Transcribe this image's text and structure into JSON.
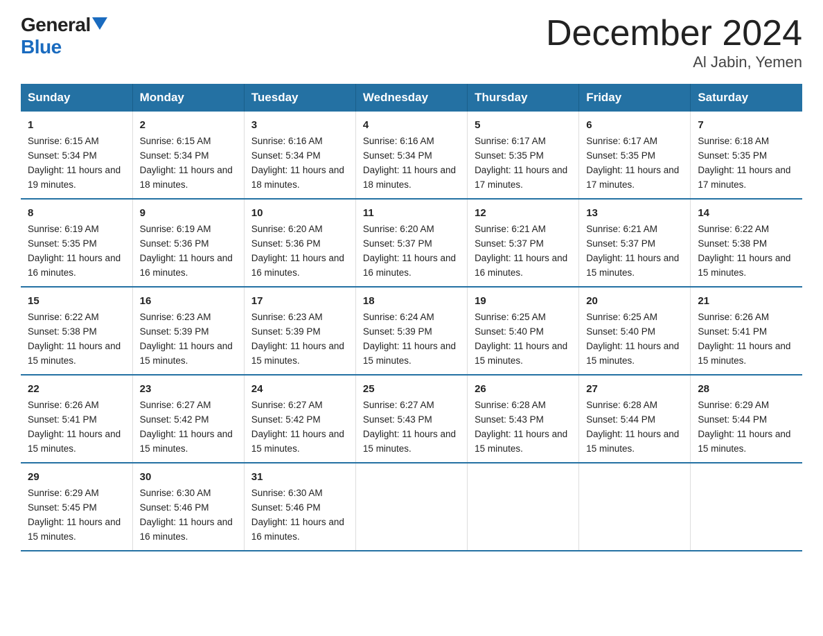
{
  "logo": {
    "general": "General",
    "blue": "Blue",
    "triangle": "▲"
  },
  "title": "December 2024",
  "subtitle": "Al Jabin, Yemen",
  "days_of_week": [
    "Sunday",
    "Monday",
    "Tuesday",
    "Wednesday",
    "Thursday",
    "Friday",
    "Saturday"
  ],
  "weeks": [
    [
      {
        "day": "1",
        "sunrise": "6:15 AM",
        "sunset": "5:34 PM",
        "daylight": "11 hours and 19 minutes."
      },
      {
        "day": "2",
        "sunrise": "6:15 AM",
        "sunset": "5:34 PM",
        "daylight": "11 hours and 18 minutes."
      },
      {
        "day": "3",
        "sunrise": "6:16 AM",
        "sunset": "5:34 PM",
        "daylight": "11 hours and 18 minutes."
      },
      {
        "day": "4",
        "sunrise": "6:16 AM",
        "sunset": "5:34 PM",
        "daylight": "11 hours and 18 minutes."
      },
      {
        "day": "5",
        "sunrise": "6:17 AM",
        "sunset": "5:35 PM",
        "daylight": "11 hours and 17 minutes."
      },
      {
        "day": "6",
        "sunrise": "6:17 AM",
        "sunset": "5:35 PM",
        "daylight": "11 hours and 17 minutes."
      },
      {
        "day": "7",
        "sunrise": "6:18 AM",
        "sunset": "5:35 PM",
        "daylight": "11 hours and 17 minutes."
      }
    ],
    [
      {
        "day": "8",
        "sunrise": "6:19 AM",
        "sunset": "5:35 PM",
        "daylight": "11 hours and 16 minutes."
      },
      {
        "day": "9",
        "sunrise": "6:19 AM",
        "sunset": "5:36 PM",
        "daylight": "11 hours and 16 minutes."
      },
      {
        "day": "10",
        "sunrise": "6:20 AM",
        "sunset": "5:36 PM",
        "daylight": "11 hours and 16 minutes."
      },
      {
        "day": "11",
        "sunrise": "6:20 AM",
        "sunset": "5:37 PM",
        "daylight": "11 hours and 16 minutes."
      },
      {
        "day": "12",
        "sunrise": "6:21 AM",
        "sunset": "5:37 PM",
        "daylight": "11 hours and 16 minutes."
      },
      {
        "day": "13",
        "sunrise": "6:21 AM",
        "sunset": "5:37 PM",
        "daylight": "11 hours and 15 minutes."
      },
      {
        "day": "14",
        "sunrise": "6:22 AM",
        "sunset": "5:38 PM",
        "daylight": "11 hours and 15 minutes."
      }
    ],
    [
      {
        "day": "15",
        "sunrise": "6:22 AM",
        "sunset": "5:38 PM",
        "daylight": "11 hours and 15 minutes."
      },
      {
        "day": "16",
        "sunrise": "6:23 AM",
        "sunset": "5:39 PM",
        "daylight": "11 hours and 15 minutes."
      },
      {
        "day": "17",
        "sunrise": "6:23 AM",
        "sunset": "5:39 PM",
        "daylight": "11 hours and 15 minutes."
      },
      {
        "day": "18",
        "sunrise": "6:24 AM",
        "sunset": "5:39 PM",
        "daylight": "11 hours and 15 minutes."
      },
      {
        "day": "19",
        "sunrise": "6:25 AM",
        "sunset": "5:40 PM",
        "daylight": "11 hours and 15 minutes."
      },
      {
        "day": "20",
        "sunrise": "6:25 AM",
        "sunset": "5:40 PM",
        "daylight": "11 hours and 15 minutes."
      },
      {
        "day": "21",
        "sunrise": "6:26 AM",
        "sunset": "5:41 PM",
        "daylight": "11 hours and 15 minutes."
      }
    ],
    [
      {
        "day": "22",
        "sunrise": "6:26 AM",
        "sunset": "5:41 PM",
        "daylight": "11 hours and 15 minutes."
      },
      {
        "day": "23",
        "sunrise": "6:27 AM",
        "sunset": "5:42 PM",
        "daylight": "11 hours and 15 minutes."
      },
      {
        "day": "24",
        "sunrise": "6:27 AM",
        "sunset": "5:42 PM",
        "daylight": "11 hours and 15 minutes."
      },
      {
        "day": "25",
        "sunrise": "6:27 AM",
        "sunset": "5:43 PM",
        "daylight": "11 hours and 15 minutes."
      },
      {
        "day": "26",
        "sunrise": "6:28 AM",
        "sunset": "5:43 PM",
        "daylight": "11 hours and 15 minutes."
      },
      {
        "day": "27",
        "sunrise": "6:28 AM",
        "sunset": "5:44 PM",
        "daylight": "11 hours and 15 minutes."
      },
      {
        "day": "28",
        "sunrise": "6:29 AM",
        "sunset": "5:44 PM",
        "daylight": "11 hours and 15 minutes."
      }
    ],
    [
      {
        "day": "29",
        "sunrise": "6:29 AM",
        "sunset": "5:45 PM",
        "daylight": "11 hours and 15 minutes."
      },
      {
        "day": "30",
        "sunrise": "6:30 AM",
        "sunset": "5:46 PM",
        "daylight": "11 hours and 16 minutes."
      },
      {
        "day": "31",
        "sunrise": "6:30 AM",
        "sunset": "5:46 PM",
        "daylight": "11 hours and 16 minutes."
      },
      {
        "day": "",
        "sunrise": "",
        "sunset": "",
        "daylight": ""
      },
      {
        "day": "",
        "sunrise": "",
        "sunset": "",
        "daylight": ""
      },
      {
        "day": "",
        "sunrise": "",
        "sunset": "",
        "daylight": ""
      },
      {
        "day": "",
        "sunrise": "",
        "sunset": "",
        "daylight": ""
      }
    ]
  ]
}
